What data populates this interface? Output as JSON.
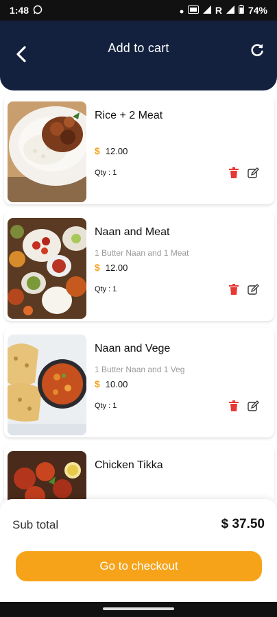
{
  "status_bar": {
    "time": "1:48",
    "battery": "74%",
    "network_letter": "R"
  },
  "header": {
    "title": "Add to cart"
  },
  "cart": {
    "items": [
      {
        "name": "Rice + 2 Meat",
        "description": "",
        "currency": "$",
        "price": "12.00",
        "qty": "Qty : 1"
      },
      {
        "name": "Naan and Meat",
        "description": "1 Butter Naan and 1 Meat",
        "currency": "$",
        "price": "12.00",
        "qty": "Qty : 1"
      },
      {
        "name": "Naan and Vege",
        "description": "1 Butter Naan and 1 Veg",
        "currency": "$",
        "price": "10.00",
        "qty": "Qty : 1"
      },
      {
        "name": "Chicken Tikka"
      }
    ]
  },
  "summary": {
    "subtotal_label": "Sub total",
    "subtotal_value": "$ 37.50",
    "checkout_label": "Go to checkout"
  },
  "colors": {
    "header_bg": "#13213f",
    "accent": "#f6a31a",
    "delete_red": "#e53935"
  }
}
